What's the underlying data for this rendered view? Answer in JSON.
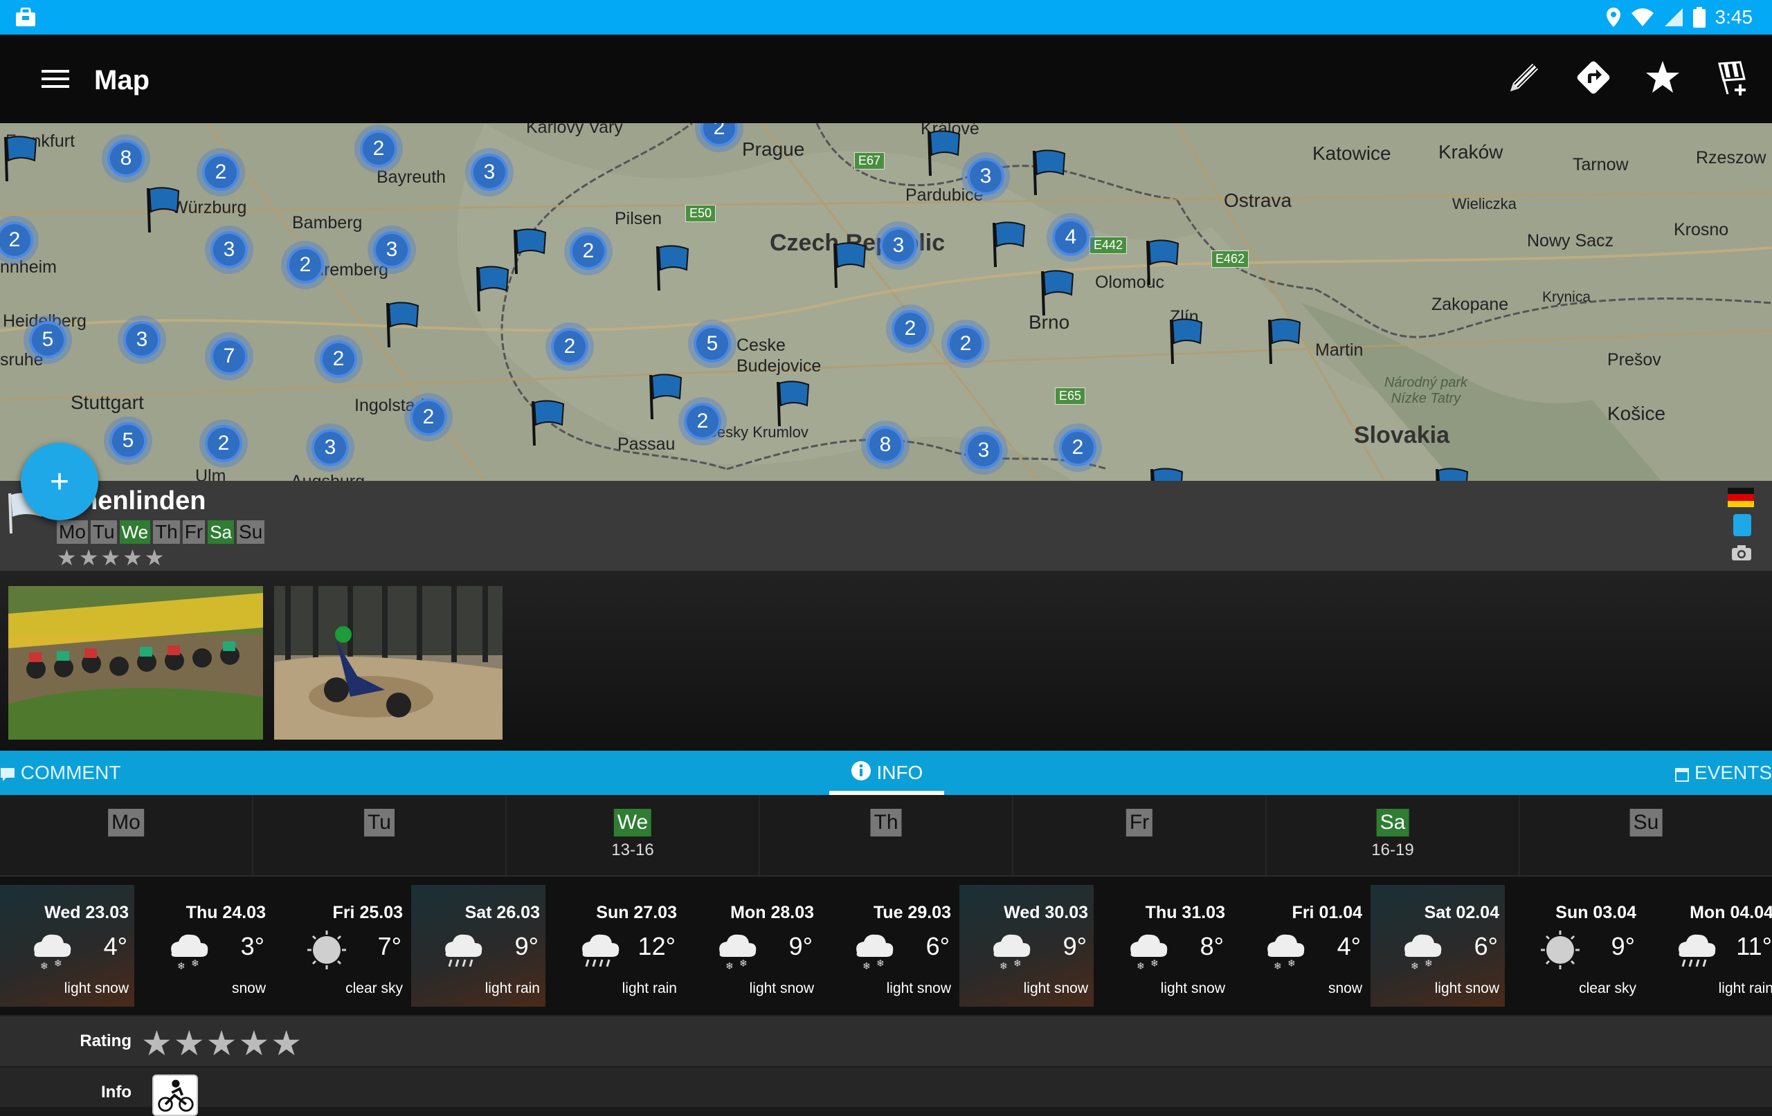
{
  "status_bar": {
    "time": "3:45"
  },
  "app_bar": {
    "title": "Map",
    "actions": [
      "pencil-icon",
      "directions-icon",
      "star-icon",
      "checkered-flag-add-icon"
    ]
  },
  "map": {
    "labels": [
      "Frankfurt",
      "Prague",
      "Katowice",
      "Kraków",
      "Rzeszow",
      "Bayreuth",
      "Würzburg",
      "Bamberg",
      "Pilsen",
      "Pardubice",
      "Ostrava",
      "Wieliczka",
      "Tarnow",
      "Krosno",
      "Nowy Sacz",
      "Czech Republic",
      "Olomouc",
      "Zakopane",
      "Krynica",
      "nnheim",
      "Nuremberg",
      "Heidelberg",
      "Brno",
      "Zlín",
      "Martin",
      "Prešov",
      "Ceske Budejovice",
      "Stuttgart",
      "Ingolstadt",
      "Passau",
      "Cesky Krumlov",
      "Košice",
      "Slovakia",
      "Národný park Nízke Tatry",
      "sruhe",
      "Ulm",
      "Augsburg",
      "Karlovy Vary",
      "Králové"
    ],
    "roads": [
      "E67",
      "E50",
      "E442",
      "E462",
      "E65"
    ],
    "clusters": [
      "8",
      "2",
      "2",
      "3",
      "2",
      "3",
      "2",
      "3",
      "3",
      "2",
      "3",
      "4",
      "5",
      "3",
      "7",
      "2",
      "2",
      "5",
      "2",
      "2",
      "2",
      "5",
      "2",
      "3",
      "2",
      "8",
      "3",
      "2",
      "2"
    ]
  },
  "venue": {
    "name": "henlinden",
    "days": [
      {
        "label": "Mo",
        "on": false
      },
      {
        "label": "Tu",
        "on": false
      },
      {
        "label": "We",
        "on": true
      },
      {
        "label": "Th",
        "on": false
      },
      {
        "label": "Fr",
        "on": false
      },
      {
        "label": "Sa",
        "on": true
      },
      {
        "label": "Su",
        "on": false
      }
    ],
    "stars": "★★★★★"
  },
  "tabs": {
    "comment": "COMMENT",
    "info": "INFO",
    "events": "EVENTS"
  },
  "week": [
    {
      "label": "Mo",
      "on": false,
      "hours": ""
    },
    {
      "label": "Tu",
      "on": false,
      "hours": ""
    },
    {
      "label": "We",
      "on": true,
      "hours": "13-16"
    },
    {
      "label": "Th",
      "on": false,
      "hours": ""
    },
    {
      "label": "Fr",
      "on": false,
      "hours": ""
    },
    {
      "label": "Sa",
      "on": true,
      "hours": "16-19"
    },
    {
      "label": "Su",
      "on": false,
      "hours": ""
    }
  ],
  "forecast": [
    {
      "date": "Wed 23.03",
      "temp": "4°",
      "cond": "light snow",
      "icon": "snow-cloud-icon",
      "hl": true
    },
    {
      "date": "Thu 24.03",
      "temp": "3°",
      "cond": "snow",
      "icon": "snow-cloud-icon",
      "hl": false
    },
    {
      "date": "Fri 25.03",
      "temp": "7°",
      "cond": "clear sky",
      "icon": "sun-icon",
      "hl": false
    },
    {
      "date": "Sat 26.03",
      "temp": "9°",
      "cond": "light rain",
      "icon": "rain-cloud-icon",
      "hl": true
    },
    {
      "date": "Sun 27.03",
      "temp": "12°",
      "cond": "light rain",
      "icon": "rain-cloud-icon",
      "hl": false
    },
    {
      "date": "Mon 28.03",
      "temp": "9°",
      "cond": "light snow",
      "icon": "snow-cloud-icon",
      "hl": false
    },
    {
      "date": "Tue 29.03",
      "temp": "6°",
      "cond": "light snow",
      "icon": "snow-cloud-icon",
      "hl": false
    },
    {
      "date": "Wed 30.03",
      "temp": "9°",
      "cond": "light snow",
      "icon": "snow-cloud-icon",
      "hl": true
    },
    {
      "date": "Thu 31.03",
      "temp": "8°",
      "cond": "light snow",
      "icon": "snow-cloud-icon",
      "hl": false
    },
    {
      "date": "Fri 01.04",
      "temp": "4°",
      "cond": "snow",
      "icon": "snow-cloud-icon",
      "hl": false
    },
    {
      "date": "Sat 02.04",
      "temp": "6°",
      "cond": "light snow",
      "icon": "snow-cloud-icon",
      "hl": true
    },
    {
      "date": "Sun 03.04",
      "temp": "9°",
      "cond": "clear sky",
      "icon": "sun-icon",
      "hl": false
    },
    {
      "date": "Mon 04.04",
      "temp": "11°",
      "cond": "light rain",
      "icon": "rain-cloud-icon",
      "hl": false
    }
  ],
  "details": {
    "rating_label": "Rating",
    "rating_stars": "★★★★★",
    "info_label": "Info"
  },
  "colors": {
    "accent": "#03a9f4",
    "tabbar": "#0ba0d8",
    "active_day": "#2e7d32"
  }
}
